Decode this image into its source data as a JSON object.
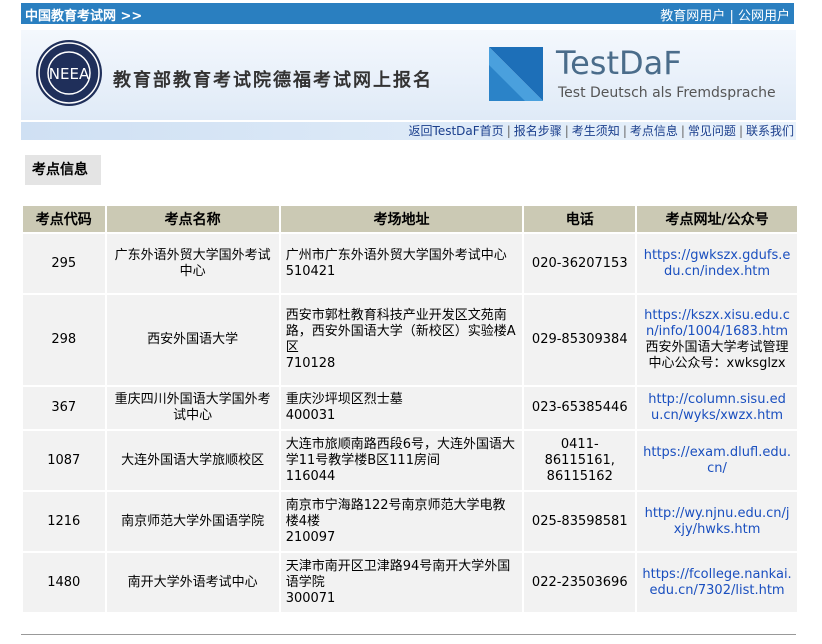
{
  "topbar": {
    "site_link": "中国教育考试网 >>",
    "user_edu": "教育网用户",
    "user_sep": "|",
    "user_public": "公网用户"
  },
  "banner": {
    "logo_text": "NEEA",
    "title": "教育部教育考试院德福考试网上报名",
    "testdaf_name": "TestDaF",
    "testdaf_sub": "Test Deutsch als Fremdsprache"
  },
  "nav": {
    "items": [
      "返回TestDaF首页",
      "报名步骤",
      "考生须知",
      "考点信息",
      "常见问题",
      "联系我们"
    ],
    "sep": "|"
  },
  "section_title": "考点信息",
  "table": {
    "headers": [
      "考点代码",
      "考点名称",
      "考场地址",
      "电话",
      "考点网址/公众号"
    ],
    "rows": [
      {
        "code": "295",
        "name": "广东外语外贸大学国外考试中心",
        "address": "广州市广东外语外贸大学国外考试中心",
        "postcode": "510421",
        "phone": "020-36207153",
        "url": "https://gwkszx.gdufs.edu.cn/index.htm",
        "wechat": ""
      },
      {
        "code": "298",
        "name": "西安外国语大学",
        "address": "西安市郭杜教育科技产业开发区文苑南路，西安外国语大学（新校区）实验楼A区",
        "postcode": "710128",
        "phone": "029-85309384",
        "url": "https://kszx.xisu.edu.cn/info/1004/1683.htm",
        "wechat": "西安外国语大学考试管理中心公众号：xwksglzx"
      },
      {
        "code": "367",
        "name": "重庆四川外国语大学国外考试中心",
        "address": "重庆沙坪坝区烈士墓",
        "postcode": "400031",
        "phone": "023-65385446",
        "url": "http://column.sisu.edu.cn/wyks/xwzx.htm",
        "wechat": ""
      },
      {
        "code": "1087",
        "name": "大连外国语大学旅顺校区",
        "address": "大连市旅顺南路西段6号，大连外国语大学11号教学楼B区111房间",
        "postcode": "116044",
        "phone": "0411-86115161, 86115162",
        "url": "https://exam.dlufl.edu.cn/",
        "wechat": ""
      },
      {
        "code": "1216",
        "name": "南京师范大学外国语学院",
        "address": "南京市宁海路122号南京师范大学电教楼4楼",
        "postcode": "210097",
        "phone": "025-83598581",
        "url": "http://wy.njnu.edu.cn/jxjy/hwks.htm",
        "wechat": ""
      },
      {
        "code": "1480",
        "name": "南开大学外语考试中心",
        "address": "天津市南开区卫津路94号南开大学外国语学院",
        "postcode": "300071",
        "phone": "022-23503696",
        "url": "https://fcollege.nankai.edu.cn/7302/list.htm",
        "wechat": ""
      }
    ]
  }
}
